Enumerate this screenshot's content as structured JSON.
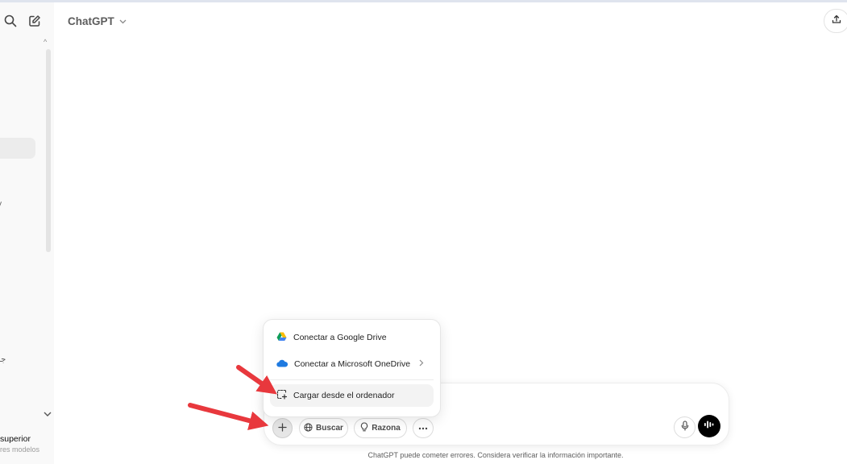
{
  "header": {
    "model_name": "ChatGPT"
  },
  "sidebar": {
    "fragment_1": "y",
    "fragment_2": "جو",
    "upgrade_title": "superior",
    "upgrade_subtitle": "res modelos"
  },
  "menu": {
    "items": [
      {
        "label": "Conectar a Google Drive",
        "icon": "google-drive-icon"
      },
      {
        "label": "Conectar a Microsoft OneDrive",
        "icon": "onedrive-icon",
        "has_submenu": true
      },
      {
        "label": "Cargar desde el ordenador",
        "icon": "upload-file-icon",
        "highlighted": true
      }
    ]
  },
  "composer": {
    "search_label": "Buscar",
    "reason_label": "Razona"
  },
  "footer": {
    "disclaimer": "ChatGPT puede cometer errores. Considera verificar la información importante."
  },
  "colors": {
    "annotation_arrow": "#e8383d",
    "voice_button": "#000000",
    "sidebar_bg": "#f9f9f9"
  }
}
